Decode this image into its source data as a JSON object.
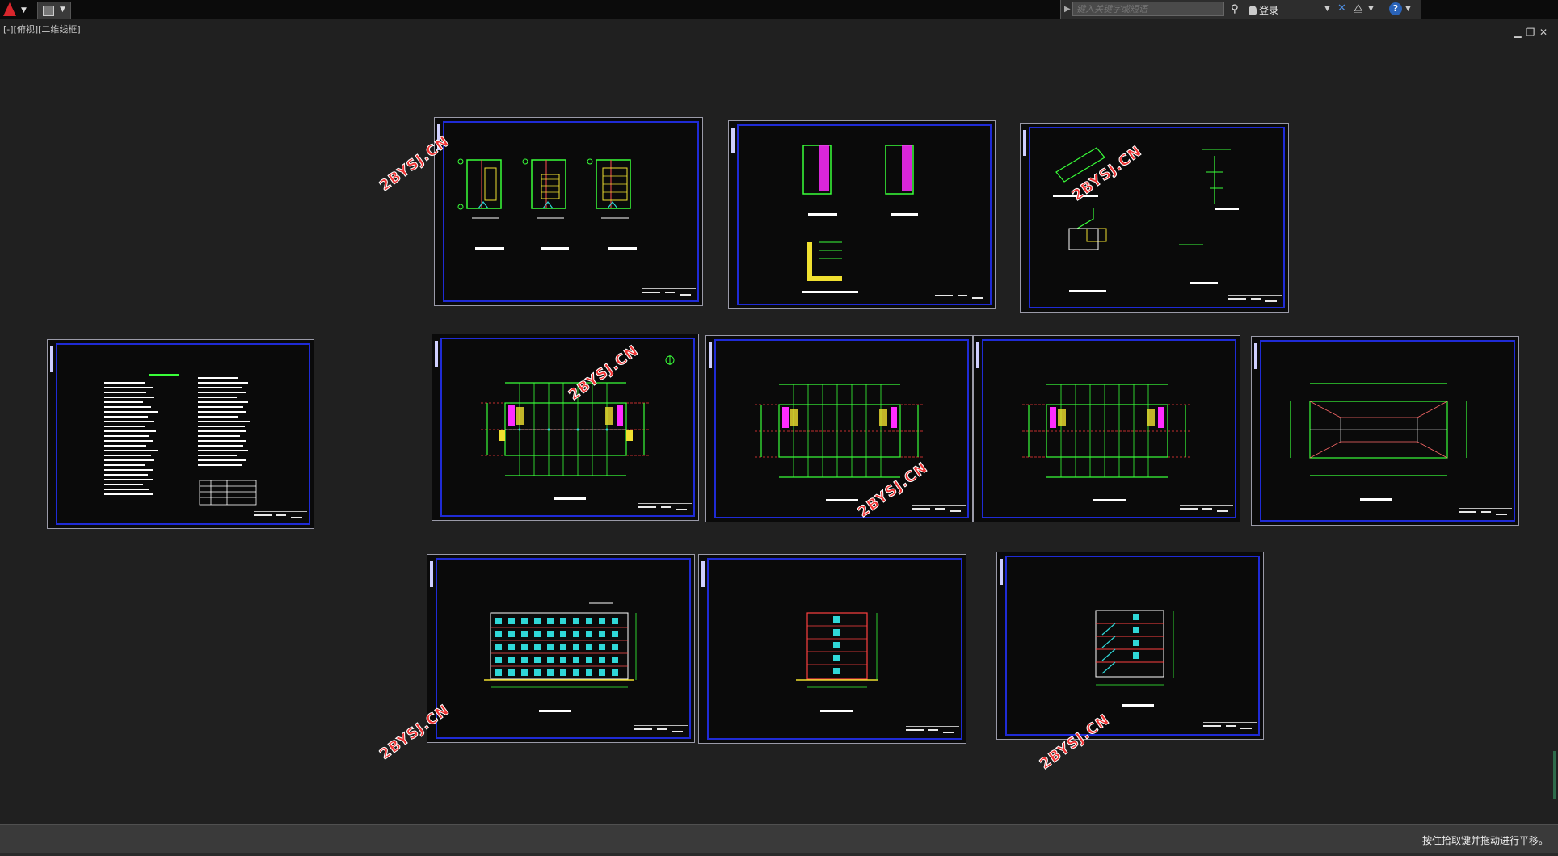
{
  "topbar": {
    "app_icon": "autocad-a-icon",
    "qat_icon": "document-edit-icon",
    "search_placeholder": "键入关键字或短语",
    "login_label": "登录",
    "help_label": "?"
  },
  "viewport": {
    "label": "[-][俯视][二维线框]"
  },
  "watermark": {
    "text": "2BYSJ.CN",
    "color": "#f03434"
  },
  "status": {
    "message": "按住拾取键并拖动进行平移。"
  },
  "colors": {
    "background": "#202020",
    "frame": "#1f2bd6",
    "walls": "#39ff39",
    "hatch": "#ff2cff",
    "stairs": "#f0e030",
    "windows": "#2fd7d7",
    "axis": "#ff3a3a"
  }
}
